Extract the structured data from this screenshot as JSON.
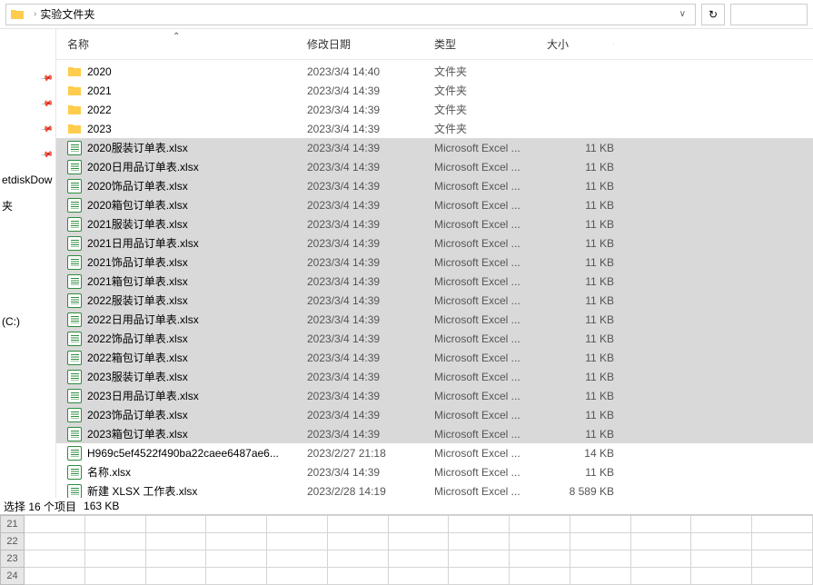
{
  "address": {
    "sep": "›",
    "folder": "实验文件夹",
    "dropdown": "∨",
    "refresh": "↻"
  },
  "sidebar": {
    "items": [
      {
        "label": "",
        "pin": true
      },
      {
        "label": "",
        "pin": true
      },
      {
        "label": "",
        "pin": true
      },
      {
        "label": "",
        "pin": true
      },
      {
        "label": "etdiskDow",
        "pin": false
      },
      {
        "label": "夹",
        "pin": false
      }
    ],
    "drive": "(C:)"
  },
  "columns": {
    "name": "名称",
    "date": "修改日期",
    "type": "类型",
    "size": "大小",
    "sort": "⌃"
  },
  "rows": [
    {
      "icon": "folder",
      "name": "2020",
      "date": "2023/3/4 14:40",
      "type": "文件夹",
      "size": "",
      "sel": false
    },
    {
      "icon": "folder",
      "name": "2021",
      "date": "2023/3/4 14:39",
      "type": "文件夹",
      "size": "",
      "sel": false
    },
    {
      "icon": "folder",
      "name": "2022",
      "date": "2023/3/4 14:39",
      "type": "文件夹",
      "size": "",
      "sel": false
    },
    {
      "icon": "folder",
      "name": "2023",
      "date": "2023/3/4 14:39",
      "type": "文件夹",
      "size": "",
      "sel": false
    },
    {
      "icon": "excel",
      "name": "2020服装订单表.xlsx",
      "date": "2023/3/4 14:39",
      "type": "Microsoft Excel ...",
      "size": "11 KB",
      "sel": true
    },
    {
      "icon": "excel",
      "name": "2020日用品订单表.xlsx",
      "date": "2023/3/4 14:39",
      "type": "Microsoft Excel ...",
      "size": "11 KB",
      "sel": true
    },
    {
      "icon": "excel",
      "name": "2020饰品订单表.xlsx",
      "date": "2023/3/4 14:39",
      "type": "Microsoft Excel ...",
      "size": "11 KB",
      "sel": true
    },
    {
      "icon": "excel",
      "name": "2020箱包订单表.xlsx",
      "date": "2023/3/4 14:39",
      "type": "Microsoft Excel ...",
      "size": "11 KB",
      "sel": true
    },
    {
      "icon": "excel",
      "name": "2021服装订单表.xlsx",
      "date": "2023/3/4 14:39",
      "type": "Microsoft Excel ...",
      "size": "11 KB",
      "sel": true
    },
    {
      "icon": "excel",
      "name": "2021日用品订单表.xlsx",
      "date": "2023/3/4 14:39",
      "type": "Microsoft Excel ...",
      "size": "11 KB",
      "sel": true
    },
    {
      "icon": "excel",
      "name": "2021饰品订单表.xlsx",
      "date": "2023/3/4 14:39",
      "type": "Microsoft Excel ...",
      "size": "11 KB",
      "sel": true
    },
    {
      "icon": "excel",
      "name": "2021箱包订单表.xlsx",
      "date": "2023/3/4 14:39",
      "type": "Microsoft Excel ...",
      "size": "11 KB",
      "sel": true
    },
    {
      "icon": "excel",
      "name": "2022服装订单表.xlsx",
      "date": "2023/3/4 14:39",
      "type": "Microsoft Excel ...",
      "size": "11 KB",
      "sel": true
    },
    {
      "icon": "excel",
      "name": "2022日用品订单表.xlsx",
      "date": "2023/3/4 14:39",
      "type": "Microsoft Excel ...",
      "size": "11 KB",
      "sel": true
    },
    {
      "icon": "excel",
      "name": "2022饰品订单表.xlsx",
      "date": "2023/3/4 14:39",
      "type": "Microsoft Excel ...",
      "size": "11 KB",
      "sel": true
    },
    {
      "icon": "excel",
      "name": "2022箱包订单表.xlsx",
      "date": "2023/3/4 14:39",
      "type": "Microsoft Excel ...",
      "size": "11 KB",
      "sel": true
    },
    {
      "icon": "excel",
      "name": "2023服装订单表.xlsx",
      "date": "2023/3/4 14:39",
      "type": "Microsoft Excel ...",
      "size": "11 KB",
      "sel": true
    },
    {
      "icon": "excel",
      "name": "2023日用品订单表.xlsx",
      "date": "2023/3/4 14:39",
      "type": "Microsoft Excel ...",
      "size": "11 KB",
      "sel": true
    },
    {
      "icon": "excel",
      "name": "2023饰品订单表.xlsx",
      "date": "2023/3/4 14:39",
      "type": "Microsoft Excel ...",
      "size": "11 KB",
      "sel": true
    },
    {
      "icon": "excel",
      "name": "2023箱包订单表.xlsx",
      "date": "2023/3/4 14:39",
      "type": "Microsoft Excel ...",
      "size": "11 KB",
      "sel": true
    },
    {
      "icon": "excel",
      "name": "H969c5ef4522f490ba22caee6487ae6...",
      "date": "2023/2/27 21:18",
      "type": "Microsoft Excel ...",
      "size": "14 KB",
      "sel": false
    },
    {
      "icon": "excel",
      "name": "名称.xlsx",
      "date": "2023/3/4 14:39",
      "type": "Microsoft Excel ...",
      "size": "11 KB",
      "sel": false
    },
    {
      "icon": "excel",
      "name": "新建 XLSX 工作表.xlsx",
      "date": "2023/2/28 14:19",
      "type": "Microsoft Excel ...",
      "size": "8 589 KB",
      "sel": false
    }
  ],
  "status": {
    "selection": "选择 16 个项目",
    "size": "163 KB"
  },
  "sheet": {
    "rows": [
      "21",
      "22",
      "23",
      "24"
    ]
  }
}
